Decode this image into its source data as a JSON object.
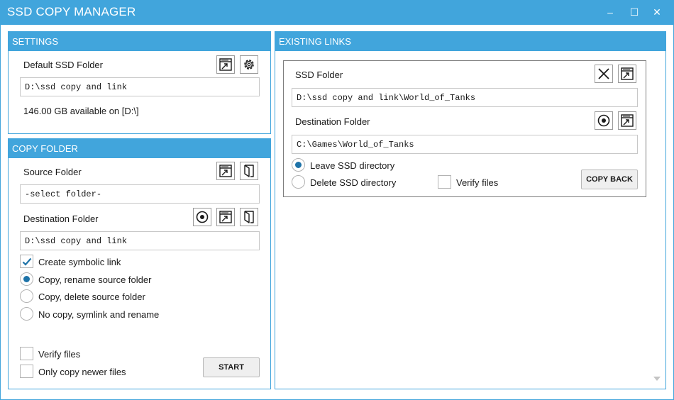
{
  "app": {
    "title": "SSD COPY MANAGER",
    "controls": {
      "minimize": "–",
      "maximize": "☐",
      "close": "✕"
    },
    "accent_color": "#41a5dc"
  },
  "settings": {
    "header": "SETTINGS",
    "default_folder_label": "Default SSD Folder",
    "default_folder_value": "D:\\ssd copy and link",
    "available_space": "146.00 GB available on [D:\\]"
  },
  "copy_folder": {
    "header": "COPY FOLDER",
    "source_label": "Source Folder",
    "source_value": "-select folder-",
    "destination_label": "Destination Folder",
    "destination_value": "D:\\ssd copy and link",
    "options": {
      "create_symlink": "Create symbolic link",
      "copy_rename": "Copy, rename source folder",
      "copy_delete": "Copy, delete source folder",
      "no_copy": "No copy, symlink and rename"
    },
    "verify_files": "Verify files",
    "only_newer": "Only copy newer files",
    "start_label": "START"
  },
  "existing_links": {
    "header": "EXISTING LINKS",
    "link": {
      "ssd_label": "SSD Folder",
      "ssd_value": "D:\\ssd copy and link\\World_of_Tanks",
      "destination_label": "Destination Folder",
      "destination_value": "C:\\Games\\World_of_Tanks",
      "leave_ssd": "Leave SSD directory",
      "delete_ssd": "Delete SSD directory",
      "verify_files": "Verify files",
      "copy_back_label": "COPY BACK"
    }
  },
  "icons": {
    "open": "open-folder-icon",
    "settings": "gear-icon",
    "browse": "browse-folder-icon",
    "drive": "drive-icon",
    "remove": "close-icon"
  }
}
